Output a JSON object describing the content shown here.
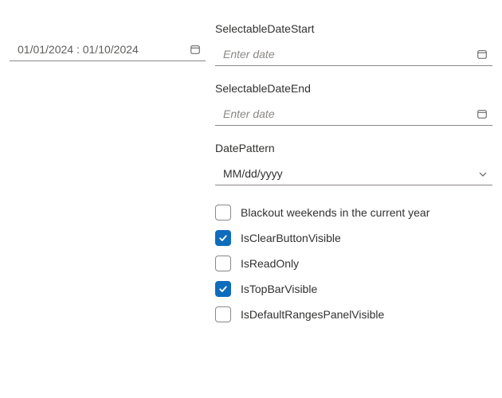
{
  "dateRange": {
    "value": "01/01/2024 : 01/10/2024"
  },
  "fields": {
    "selectableStart": {
      "label": "SelectableDateStart",
      "placeholder": "Enter date",
      "value": ""
    },
    "selectableEnd": {
      "label": "SelectableDateEnd",
      "placeholder": "Enter date",
      "value": ""
    },
    "datePattern": {
      "label": "DatePattern",
      "value": "MM/dd/yyyy"
    }
  },
  "checkboxes": [
    {
      "id": "blackout-weekends",
      "label": "Blackout weekends in the current year",
      "checked": false
    },
    {
      "id": "is-clear-button-visible",
      "label": "IsClearButtonVisible",
      "checked": true
    },
    {
      "id": "is-read-only",
      "label": "IsReadOnly",
      "checked": false
    },
    {
      "id": "is-top-bar-visible",
      "label": "IsTopBarVisible",
      "checked": true
    },
    {
      "id": "is-default-ranges-panel-visible",
      "label": "IsDefaultRangesPanelVisible",
      "checked": false
    }
  ]
}
